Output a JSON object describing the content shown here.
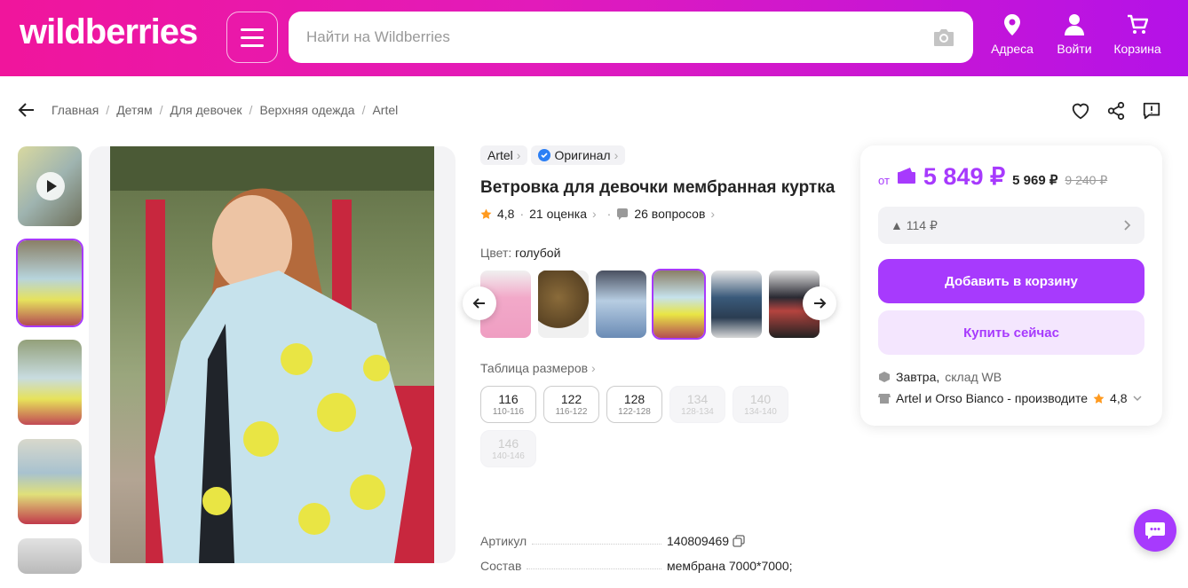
{
  "header": {
    "logo": "wildberries",
    "search_placeholder": "Найти на Wildberries",
    "nav": [
      {
        "label": "Адреса",
        "icon": "location-icon"
      },
      {
        "label": "Войти",
        "icon": "user-icon"
      },
      {
        "label": "Корзина",
        "icon": "cart-icon"
      }
    ]
  },
  "breadcrumbs": [
    "Главная",
    "Детям",
    "Для девочек",
    "Верхняя одежда",
    "Artel"
  ],
  "product": {
    "brand": "Artel",
    "original": "Оригинал",
    "title": "Ветровка для девочки мембранная куртка",
    "rating": "4,8",
    "reviews": "21 оценка",
    "questions": "26 вопросов",
    "color_label": "Цвет:",
    "color_value": "голубой",
    "size_table": "Таблица размеров",
    "sizes": [
      {
        "n": "116",
        "r": "110-116",
        "available": true
      },
      {
        "n": "122",
        "r": "116-122",
        "available": true
      },
      {
        "n": "128",
        "r": "122-128",
        "available": true
      },
      {
        "n": "134",
        "r": "128-134",
        "available": false
      },
      {
        "n": "140",
        "r": "134-140",
        "available": false
      },
      {
        "n": "146",
        "r": "140-146",
        "available": false
      }
    ],
    "specs": [
      {
        "k": "Артикул",
        "v": "140809469"
      },
      {
        "k": "Состав",
        "v": "мембрана 7000*7000;"
      }
    ]
  },
  "buy": {
    "from": "от",
    "price": "5 849 ₽",
    "price_old1": "5 969 ₽",
    "price_old2": "9 240 ₽",
    "discount": "▲ 114 ₽",
    "add_to_cart": "Добавить в корзину",
    "buy_now": "Купить сейчас",
    "delivery": "Завтра,",
    "warehouse": "склад WB",
    "seller": "Artel и Orso Bianco - производите",
    "seller_rating": "4,8"
  },
  "colors": {
    "accent": "#a73afd",
    "header_start": "#f0159c",
    "header_end": "#b412e8"
  }
}
